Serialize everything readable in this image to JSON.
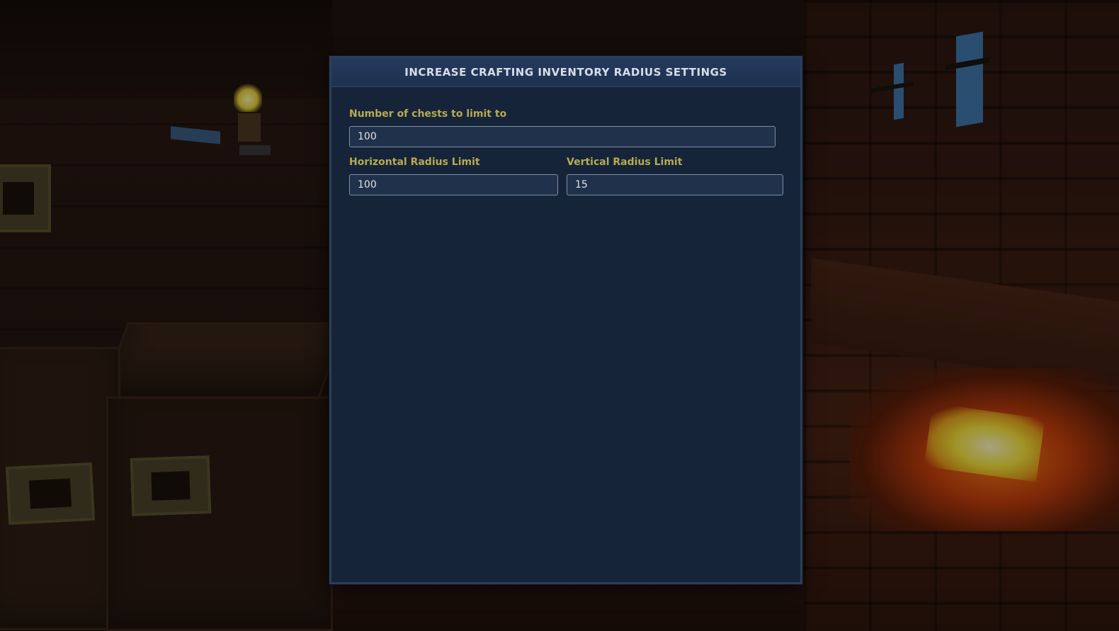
{
  "dialog": {
    "title": "INCREASE CRAFTING INVENTORY RADIUS SETTINGS",
    "fields": {
      "chests": {
        "label": "Number of chests to limit to",
        "value": "100"
      },
      "horizontal": {
        "label": "Horizontal Radius Limit",
        "value": "100"
      },
      "vertical": {
        "label": "Vertical Radius Limit",
        "value": "15"
      }
    }
  },
  "colors": {
    "panel_bg": "#16243a",
    "header_bg": "#1d3150",
    "label": "#b7ab4e",
    "title_text": "#d7dde6"
  }
}
